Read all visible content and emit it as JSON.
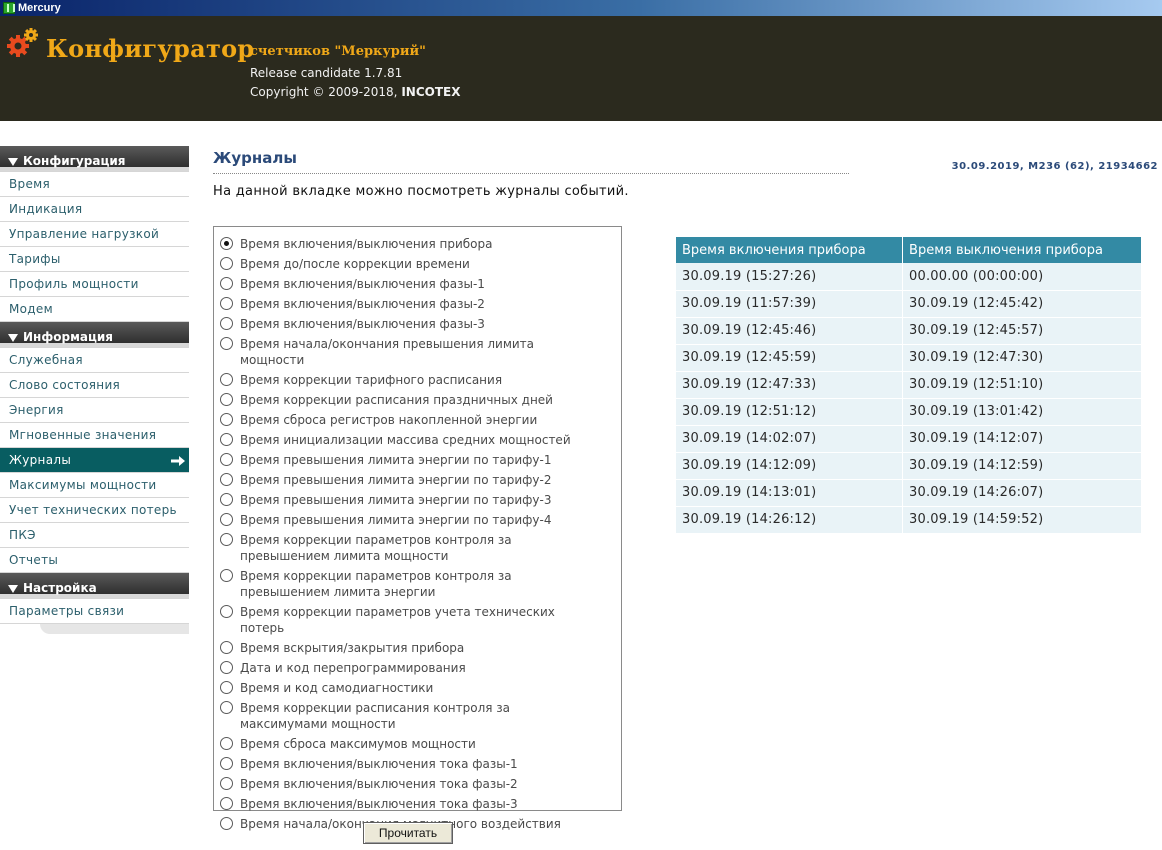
{
  "window": {
    "title": "Mercury"
  },
  "header": {
    "brand": "Конфигуратор",
    "subtitle": "счетчиков \"Меркурий\"",
    "release": "Release candidate 1.7.81",
    "copyright_prefix": "Copyright © 2009-2018, ",
    "copyright_company": "INCOTEX",
    "logo_icon": "gears-icon",
    "colors": {
      "brand": "#f0a818",
      "header_bg": "#2b2a1e"
    }
  },
  "sidebar": {
    "sections": [
      {
        "label": "Конфигурация",
        "items": [
          "Время",
          "Индикация",
          "Управление нагрузкой",
          "Тарифы",
          "Профиль мощности",
          "Модем"
        ]
      },
      {
        "label": "Информация",
        "items": [
          "Служебная",
          "Слово состояния",
          "Энергия",
          "Мгновенные значения",
          "Журналы",
          "Максимумы мощности",
          "Учет технических потерь",
          "ПКЭ",
          "Отчеты"
        ]
      },
      {
        "label": "Настройка",
        "items": [
          "Параметры связи"
        ]
      }
    ],
    "active_item": "Журналы",
    "colors": {
      "active_bg": "#085d61",
      "item_text": "#2c5f6c"
    }
  },
  "main": {
    "title": "Журналы",
    "meter_info": "30.09.2019, M236 (62), 21934662",
    "description": "На данной вкладке можно посмотреть журналы событий.",
    "journals": [
      "Время включения/выключения прибора",
      "Время до/после коррекции времени",
      "Время включения/выключения фазы-1",
      "Время включения/выключения фазы-2",
      "Время включения/выключения фазы-3",
      "Время начала/окончания превышения лимита мощности",
      "Время коррекции тарифного расписания",
      "Время коррекции расписания праздничных дней",
      "Время сброса регистров накопленной энергии",
      "Время инициализации массива средних мощностей",
      "Время превышения лимита энергии по тарифу-1",
      "Время превышения лимита энергии по тарифу-2",
      "Время превышения лимита энергии по тарифу-3",
      "Время превышения лимита энергии по тарифу-4",
      "Время коррекции параметров контроля за превышением лимита мощности",
      "Время коррекции параметров контроля за превышением лимита энергии",
      "Время коррекции параметров учета технических потерь",
      "Время вскрытия/закрытия прибора",
      "Дата и код перепрограммирования",
      "Время и код самодиагностики",
      "Время коррекции расписания контроля за максимумами мощности",
      "Время сброса максимумов мощности",
      "Время включения/выключения тока фазы-1",
      "Время включения/выключения тока фазы-2",
      "Время включения/выключения тока фазы-3",
      "Время начала/окончания магнитного воздействия"
    ],
    "selected_journal": 0,
    "read_button": "Прочитать",
    "table": {
      "headers": [
        "Время включения прибора",
        "Время выключения прибора"
      ],
      "rows": [
        [
          "30.09.19 (15:27:26)",
          "00.00.00 (00:00:00)"
        ],
        [
          "30.09.19 (11:57:39)",
          "30.09.19 (12:45:42)"
        ],
        [
          "30.09.19 (12:45:46)",
          "30.09.19 (12:45:57)"
        ],
        [
          "30.09.19 (12:45:59)",
          "30.09.19 (12:47:30)"
        ],
        [
          "30.09.19 (12:47:33)",
          "30.09.19 (12:51:10)"
        ],
        [
          "30.09.19 (12:51:12)",
          "30.09.19 (13:01:42)"
        ],
        [
          "30.09.19 (14:02:07)",
          "30.09.19 (14:12:07)"
        ],
        [
          "30.09.19 (14:12:09)",
          "30.09.19 (14:12:59)"
        ],
        [
          "30.09.19 (14:13:01)",
          "30.09.19 (14:26:07)"
        ],
        [
          "30.09.19 (14:26:12)",
          "30.09.19 (14:59:52)"
        ]
      ],
      "colors": {
        "header_bg": "#338aa4",
        "row_bg": "#e9f3f7"
      }
    }
  }
}
